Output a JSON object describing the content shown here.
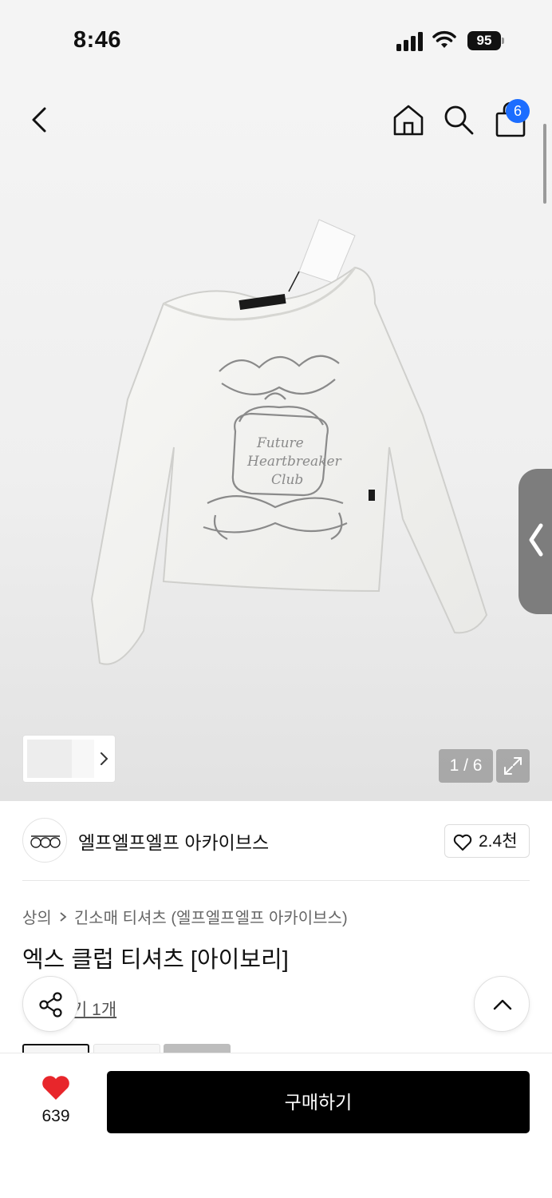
{
  "status_bar": {
    "time": "8:46",
    "battery": "95",
    "icons": [
      "signal-icon",
      "wifi-icon",
      "battery-icon"
    ]
  },
  "header": {
    "icons": [
      "back-icon",
      "home-icon",
      "search-icon",
      "cart-icon"
    ],
    "cart_count": "6"
  },
  "gallery": {
    "counter": "1 / 6",
    "image": "ivory long-sleeve t-shirt with ornate frame print",
    "icons": [
      "chevron-left-icon",
      "chevron-right-icon",
      "expand-icon"
    ]
  },
  "brand": {
    "name": "엘프엘프엘프 아카이브스",
    "likes": "2.4천"
  },
  "product": {
    "breadcrumb": [
      "상의",
      "긴소매 티셔츠 (엘프엘프엘프 아카이브스)"
    ],
    "title": "엑스 클럽 티셔츠 [아이보리]",
    "review_text": "기 1개"
  },
  "bottom_bar": {
    "like_count": "639",
    "buy_label": "구매하기"
  },
  "colors": {
    "accent": "#1c6dff",
    "heart": "#e8262b",
    "buy_button": "#000000"
  }
}
